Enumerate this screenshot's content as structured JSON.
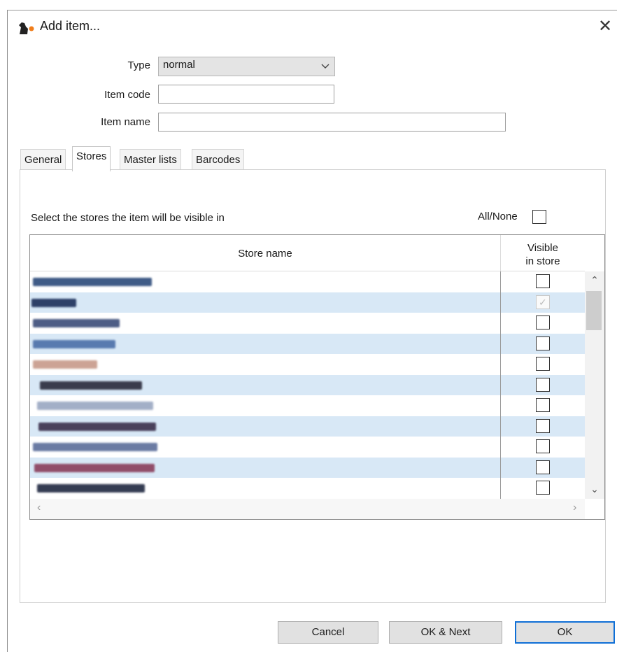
{
  "window": {
    "title": "Add item...",
    "icon": "app-logo-icon",
    "close_glyph": "✕"
  },
  "form": {
    "type_label": "Type",
    "type_value": "normal",
    "item_code_label": "Item code",
    "item_code_value": "",
    "item_name_label": "Item name",
    "item_name_value": ""
  },
  "tabs": [
    {
      "label": "General",
      "active": false
    },
    {
      "label": "Stores",
      "active": true
    },
    {
      "label": "Master lists",
      "active": false
    },
    {
      "label": "Barcodes",
      "active": false
    }
  ],
  "stores_panel": {
    "instruction": "Select the stores the item will be visible in",
    "all_none_label": "All/None",
    "columns": {
      "store_name": "Store name",
      "visible_line1": "Visible",
      "visible_line2": "in store"
    },
    "rows": [
      {
        "visible": false
      },
      {
        "visible": true
      },
      {
        "visible": false
      },
      {
        "visible": false
      },
      {
        "visible": false
      },
      {
        "visible": false
      },
      {
        "visible": false
      },
      {
        "visible": false
      },
      {
        "visible": false
      },
      {
        "visible": false
      },
      {
        "visible": false
      }
    ]
  },
  "buttons": {
    "cancel": "Cancel",
    "ok_next": "OK & Next",
    "ok": "OK"
  },
  "colors": {
    "row_highlight": "#d8e8f6",
    "default_button_border": "#0f6fd6",
    "logo_orange": "#f07d1a"
  }
}
